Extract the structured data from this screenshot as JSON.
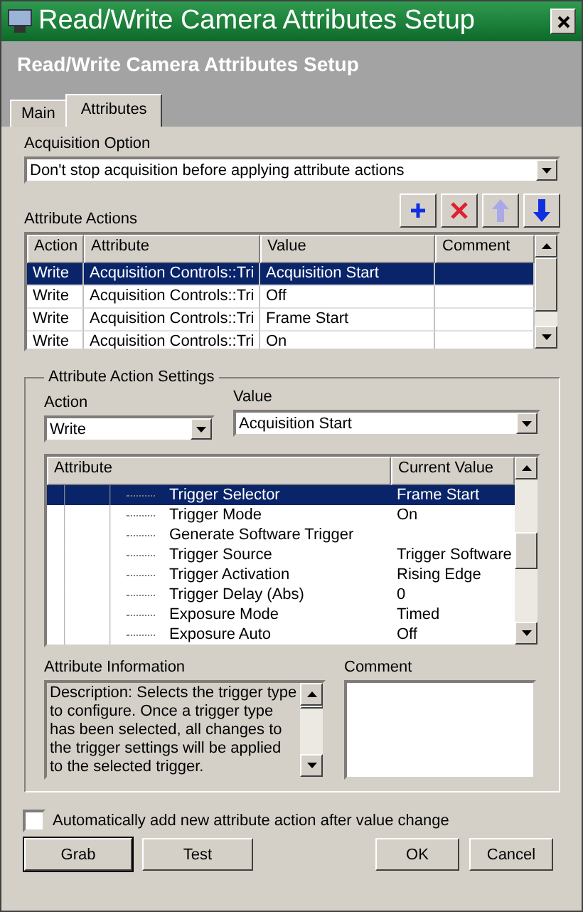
{
  "window": {
    "title": "Read/Write Camera Attributes Setup"
  },
  "header": {
    "title": "Read/Write Camera Attributes Setup"
  },
  "tabs": [
    {
      "label": "Main",
      "selected": false
    },
    {
      "label": "Attributes",
      "selected": true
    }
  ],
  "acquisition_option": {
    "label": "Acquisition Option",
    "value": "Don't stop acquisition before applying attribute actions"
  },
  "attribute_actions": {
    "label": "Attribute Actions",
    "toolbar": [
      {
        "kind": "add",
        "disabled": false
      },
      {
        "kind": "delete",
        "disabled": false
      },
      {
        "kind": "up",
        "disabled": true
      },
      {
        "kind": "down",
        "disabled": false
      }
    ],
    "columns": [
      "Action",
      "Attribute",
      "Value",
      "Comment"
    ],
    "rows": [
      {
        "cells": [
          "Write",
          "Acquisition Controls::Tri",
          "Acquisition Start",
          ""
        ],
        "selected": true
      },
      {
        "cells": [
          "Write",
          "Acquisition Controls::Tri",
          "Off",
          ""
        ],
        "selected": false
      },
      {
        "cells": [
          "Write",
          "Acquisition Controls::Tri",
          "Frame Start",
          ""
        ],
        "selected": false
      },
      {
        "cells": [
          "Write",
          "Acquisition Controls::Tri",
          "On",
          ""
        ],
        "selected": false
      }
    ]
  },
  "settings": {
    "legend": "Attribute Action Settings",
    "action": {
      "label": "Action",
      "value": "Write"
    },
    "value": {
      "label": "Value",
      "value": "Acquisition Start"
    },
    "tree": {
      "columns": [
        "Attribute",
        "Current Value"
      ],
      "rows": [
        {
          "name": "Trigger Selector",
          "value": "Frame Start",
          "selected": true
        },
        {
          "name": "Trigger Mode",
          "value": "On",
          "selected": false
        },
        {
          "name": "Generate Software Trigger",
          "selected": false
        },
        {
          "name": "Trigger Source",
          "value": "Trigger Software",
          "selected": false
        },
        {
          "name": "Trigger Activation",
          "value": "Rising Edge",
          "selected": false
        },
        {
          "name": "Trigger Delay (Abs)",
          "value": "0",
          "selected": false
        },
        {
          "name": "Exposure Mode",
          "value": "Timed",
          "selected": false
        },
        {
          "name": "Exposure Auto",
          "value": "Off",
          "selected": false
        }
      ]
    },
    "info": {
      "label": "Attribute Information",
      "text": "Description: Selects the trigger type to configure. Once a trigger type has been selected, all changes to the trigger settings will be applied to the selected trigger."
    },
    "comment": {
      "label": "Comment"
    }
  },
  "auto_add": {
    "label": "Automatically add new attribute action after value change",
    "checked": false
  },
  "buttons": [
    {
      "label": "Grab",
      "default": true
    },
    {
      "label": "Test",
      "default": false
    },
    {
      "label": "OK",
      "default": false
    },
    {
      "label": "Cancel",
      "default": false
    }
  ]
}
